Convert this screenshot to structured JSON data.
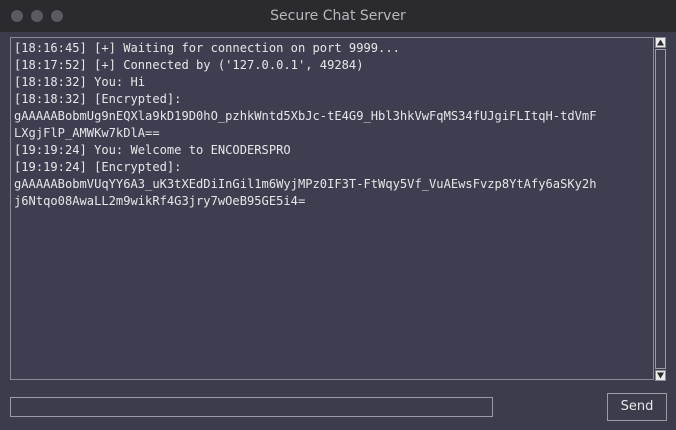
{
  "window": {
    "title": "Secure Chat Server"
  },
  "chat_log": {
    "lines": [
      "[18:16:45] [+] Waiting for connection on port 9999...",
      "[18:17:52] [+] Connected by ('127.0.0.1', 49284)",
      "[18:18:32] You: Hi",
      "[18:18:32] [Encrypted]:",
      "gAAAAABobmUg9nEQXla9kD19D0hO_pzhkWntd5XbJc-tE4G9_Hbl3hkVwFqMS34fUJgiFLItqH-tdVmF",
      "LXgjFlP_AMWKw7kDlA==",
      "[19:19:24] You: Welcome to ENCODERSPRO",
      "[19:19:24] [Encrypted]:",
      "gAAAAABobmVUqYY6A3_uK3tXEdDiInGil1m6WyjMPz0IF3T-FtWqy5Vf_VuAEwsFvzp8YtAfy6aSKy2h",
      "j6Ntqo08AwaLL2m9wikRf4G3jry7wOeB95GE5i4="
    ]
  },
  "composer": {
    "input_value": "",
    "send_label": "Send"
  },
  "icons": {
    "window_controls": [
      "close-dot",
      "minimize-dot",
      "maximize-dot"
    ],
    "scroll_up": "arrow-up-icon",
    "scroll_down": "arrow-down-icon"
  },
  "colors": {
    "titlebar": "#2a2a2f",
    "background": "#3b3d4d",
    "text": "#e6e6e8",
    "border": "#8a8b95"
  }
}
